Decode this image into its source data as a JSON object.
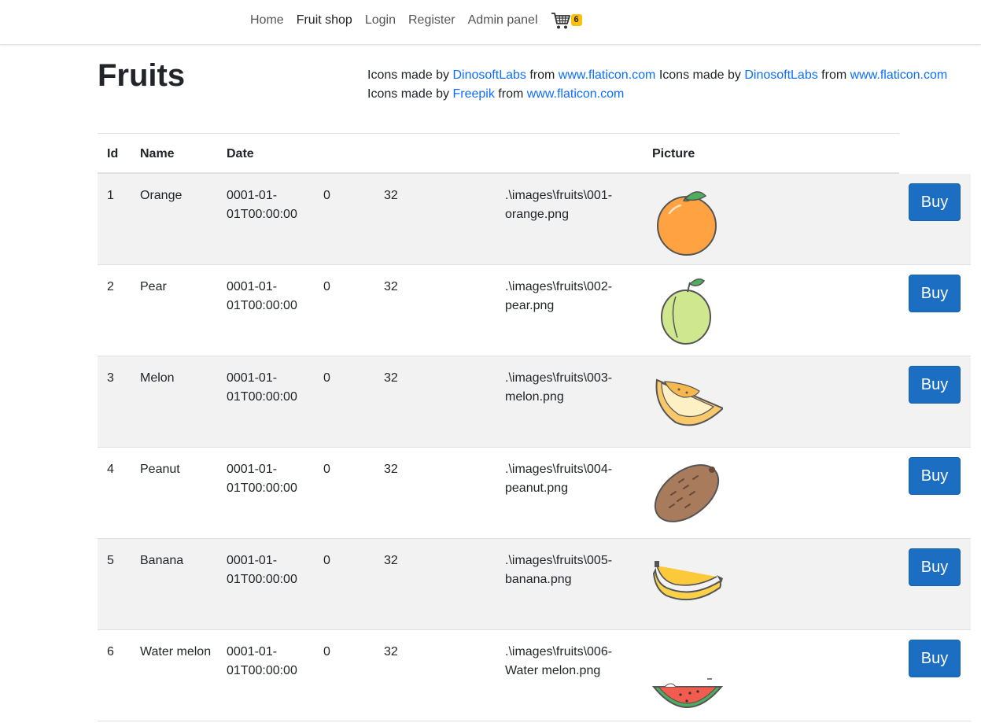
{
  "nav": {
    "links": [
      "Home",
      "Fruit shop",
      "Login",
      "Register",
      "Admin panel"
    ],
    "cart_icon": "cart-icon",
    "cart_count": "6"
  },
  "page": {
    "title": "Fruits",
    "credits": [
      {
        "prefix": "Icons made by ",
        "author": "DinosoftLabs",
        "mid": " from ",
        "site": "www.flaticon.com"
      },
      {
        "prefix": " Icons made by ",
        "author": "DinosoftLabs",
        "mid": " from ",
        "site": "www.flaticon.com"
      },
      {
        "prefix": "Icons made by ",
        "author": "Freepik",
        "mid": " from ",
        "site": "www.flaticon.com"
      }
    ]
  },
  "table": {
    "headers": [
      "Id",
      "Name",
      "Date",
      "",
      "",
      "",
      "Picture"
    ],
    "buy_label": "Buy",
    "rows": [
      {
        "id": "1",
        "name": "Orange",
        "date": "0001-01-01T00:00:00",
        "zero": "0",
        "num": "32",
        "path": ".\\images\\fruits\\001-orange.png",
        "icon": "orange-icon"
      },
      {
        "id": "2",
        "name": "Pear",
        "date": "0001-01-01T00:00:00",
        "zero": "0",
        "num": "32",
        "path": ".\\images\\fruits\\002-pear.png",
        "icon": "pear-icon"
      },
      {
        "id": "3",
        "name": "Melon",
        "date": "0001-01-01T00:00:00",
        "zero": "0",
        "num": "32",
        "path": ".\\images\\fruits\\003-melon.png",
        "icon": "melon-icon"
      },
      {
        "id": "4",
        "name": "Peanut",
        "date": "0001-01-01T00:00:00",
        "zero": "0",
        "num": "32",
        "path": ".\\images\\fruits\\004-peanut.png",
        "icon": "peanut-icon"
      },
      {
        "id": "5",
        "name": "Banana",
        "date": "0001-01-01T00:00:00",
        "zero": "0",
        "num": "32",
        "path": ".\\images\\fruits\\005-banana.png",
        "icon": "banana-icon"
      },
      {
        "id": "6",
        "name": "Water melon",
        "date": "0001-01-01T00:00:00",
        "zero": "0",
        "num": "32",
        "path": ".\\images\\fruits\\006-Water melon.png",
        "icon": "watermelon-icon"
      }
    ]
  },
  "colors": {
    "accent": "#1b6ec2",
    "link": "#0d6efd",
    "badge": "#ffc107",
    "stripe": "#f2f2f2"
  }
}
